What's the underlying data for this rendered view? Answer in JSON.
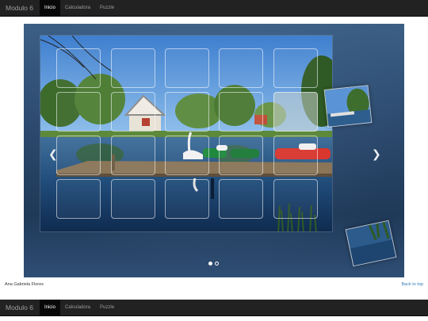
{
  "nav_top": {
    "brand": "Modulo 6",
    "items": [
      "Inicio",
      "Calculadora",
      "Puzzle"
    ],
    "active": "Inicio"
  },
  "carousel": {
    "slides": 2,
    "active_slide": 1,
    "prev_icon": "chevron-left-icon",
    "next_icon": "chevron-right-icon",
    "effect": "tile-grid transition"
  },
  "footer": {
    "author": "Ana Gabriela Flores",
    "back_to_top": "Back to top"
  },
  "nav_bottom": {
    "brand": "Modulo 6",
    "items": [
      "Inicio",
      "Calculadora",
      "Puzzle"
    ],
    "active": "Inicio"
  },
  "colors": {
    "navbar_bg": "#222222",
    "navbar_text": "#9d9d9d",
    "navbar_active_bg": "#080808",
    "link": "#337ab7"
  }
}
